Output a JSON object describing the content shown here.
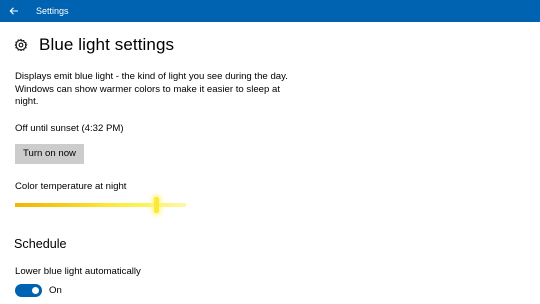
{
  "titlebar": {
    "title": "Settings",
    "back_icon": "back-arrow-icon",
    "background": "#0063b1"
  },
  "header": {
    "icon": "gear-icon",
    "title": "Blue light settings"
  },
  "description": "Displays emit blue light - the kind of light you see during the day. Windows can show warmer colors to make it easier to sleep at night.",
  "status": "Off until sunset (4:32 PM)",
  "turn_on_button": {
    "label": "Turn on now"
  },
  "color_temperature": {
    "label": "Color temperature at night",
    "value_fraction": 0.84,
    "gradient_colors": [
      "#f0b800",
      "#fbe93a",
      "#fff6a8"
    ]
  },
  "schedule": {
    "heading": "Schedule",
    "toggle_label": "Lower blue light automatically",
    "toggle_state": "On",
    "toggle_on": true,
    "accent": "#0063b1"
  }
}
